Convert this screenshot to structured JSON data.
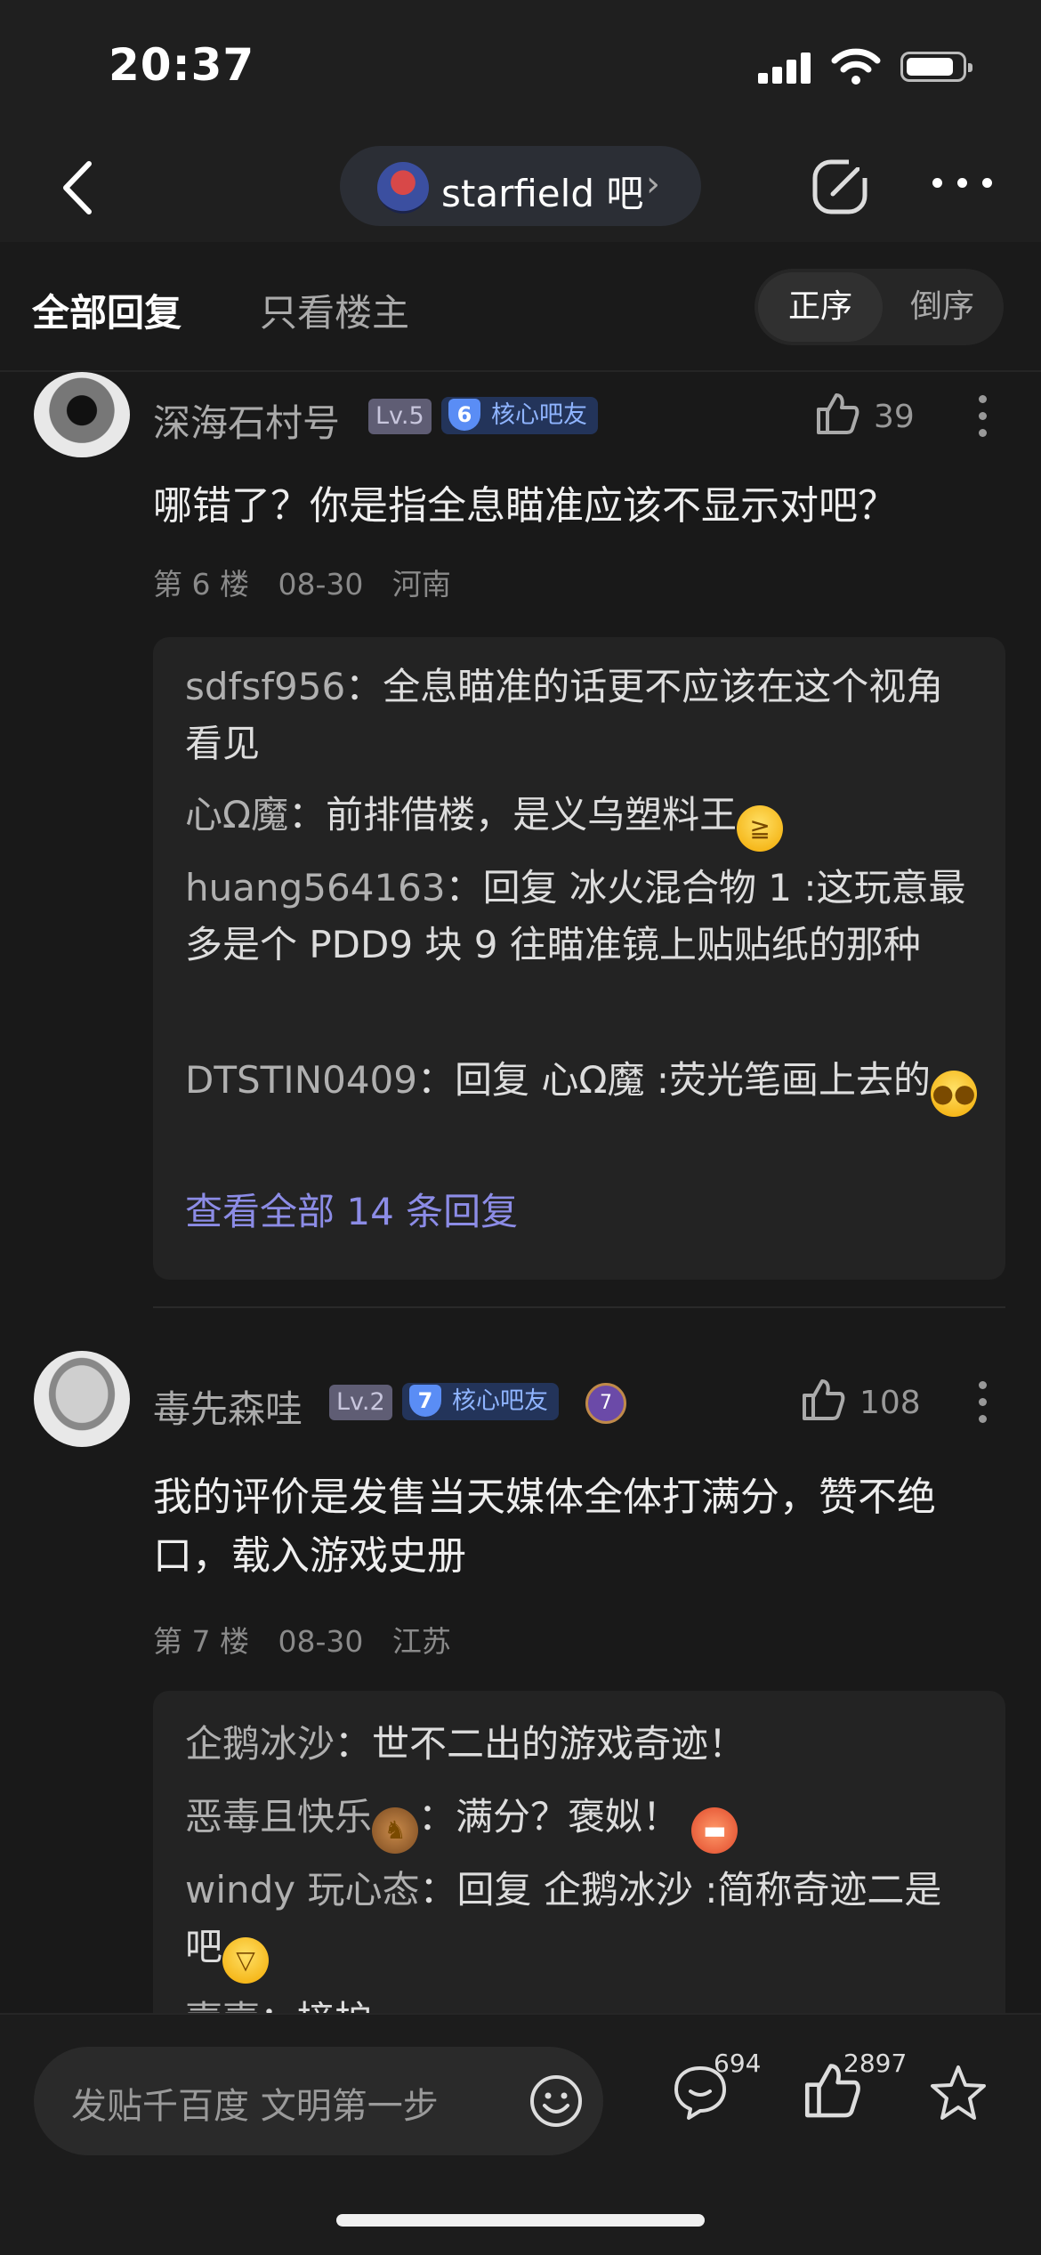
{
  "status": {
    "time": "20:37"
  },
  "nav": {
    "forum_name": "starfield 吧",
    "chevron": "›"
  },
  "tabs": {
    "all": "全部回复",
    "op_only": "只看楼主"
  },
  "sort": {
    "asc": "正序",
    "desc": "倒序"
  },
  "posts": [
    {
      "username": "深海石村号",
      "level": "Lv.5",
      "core_num": "6",
      "core_label": "核心吧友",
      "likes": "39",
      "content": "哪错了？你是指全息瞄准应该不显示对吧？",
      "floor": "第 6 楼",
      "date": "08-30",
      "location": "河南",
      "replies": [
        {
          "user": "sdfsf956",
          "text": "全息瞄准的话更不应该在这个视角看见"
        },
        {
          "user": "心Ω魔",
          "text": "前排借楼，是义乌塑料王"
        },
        {
          "user": "huang564163",
          "text": "回复 冰火混合物 1 :这玩意最多是个 PDD9 块 9 往瞄准镜上贴贴纸的那种"
        },
        {
          "user": "DTSTIN0409",
          "text": "回复 心Ω魔 :荧光笔画上去的"
        }
      ],
      "view_all": "查看全部 14 条回复"
    },
    {
      "username": "毒先森哇",
      "level": "Lv.2",
      "core_num": "7",
      "core_label": "核心吧友",
      "badge_num": "7",
      "likes": "108",
      "content": "我的评价是发售当天媒体全体打满分，赞不绝口，载入游戏史册",
      "floor": "第 7 楼",
      "date": "08-30",
      "location": "江苏",
      "replies": [
        {
          "user": "企鹅冰沙",
          "text": "世不二出的游戏奇迹！"
        },
        {
          "user": "恶毒且快乐",
          "text": "满分？褒姒！"
        },
        {
          "user": "windy 玩心态",
          "text": "回复 企鹅冰沙 :简称奇迹二是吧"
        },
        {
          "user": "壹壹",
          "text": "接护"
        }
      ]
    }
  ],
  "bottom": {
    "placeholder": "发贴千百度 文明第一步",
    "comment_count": "694",
    "like_count": "2897"
  },
  "colors": {
    "background": "#191919",
    "link": "#8c8ce6",
    "core_badge": "#5a8df5"
  }
}
